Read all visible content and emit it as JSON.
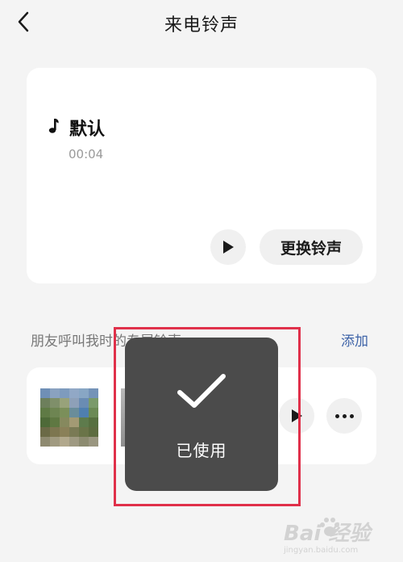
{
  "header": {
    "title": "来电铃声"
  },
  "current_ringtone": {
    "name": "默认",
    "duration": "00:04",
    "change_label": "更换铃声"
  },
  "friends_section": {
    "label": "朋友呼叫我时的专属铃声",
    "add_label": "添加"
  },
  "toast": {
    "text": "已使用"
  },
  "watermark": {
    "brand": "Bai  经验",
    "url": "jingyan.baidu.com"
  },
  "colors": {
    "background": "#f4f4f4",
    "card": "#ffffff",
    "accent_link": "#3f64a8",
    "toast_bg": "#4b4b4b",
    "highlight": "#e0304a"
  },
  "icons": [
    "back-icon",
    "music-note-icon",
    "play-icon",
    "more-icon",
    "check-icon"
  ]
}
